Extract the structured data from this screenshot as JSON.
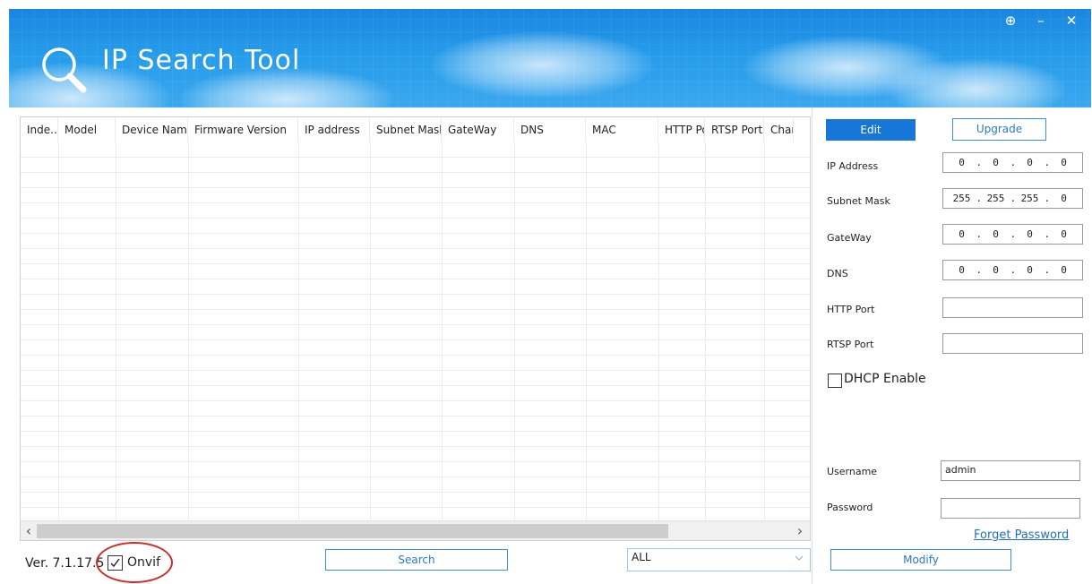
{
  "app": {
    "title": "IP Search Tool",
    "window_buttons": [
      "⊕",
      "–",
      "✕"
    ]
  },
  "table": {
    "columns": [
      "Inde...",
      "Model",
      "Device Name",
      "Firmware Version",
      "IP address",
      "Subnet Mask",
      "GateWay",
      "DNS",
      "MAC",
      "HTTP Port",
      "RTSP Port",
      "Chanr"
    ],
    "rows": []
  },
  "bottom": {
    "version": "Ver. 7.1.17.5",
    "onvif_label": "Onvif",
    "onvif_checked": true,
    "search_label": "Search",
    "filter_value": "ALL",
    "modify_label": "Modify"
  },
  "panel": {
    "edit_tab": "Edit",
    "upgrade_tab": "Upgrade",
    "ip_label": "IP Address",
    "ip_value": [
      "0",
      "0",
      "0",
      "0"
    ],
    "mask_label": "Subnet Mask",
    "mask_value": [
      "255",
      "255",
      "255",
      "0"
    ],
    "gateway_label": "GateWay",
    "gateway_value": [
      "0",
      "0",
      "0",
      "0"
    ],
    "dns_label": "DNS",
    "dns_value": [
      "0",
      "0",
      "0",
      "0"
    ],
    "http_label": "HTTP Port",
    "http_value": "",
    "rtsp_label": "RTSP Port",
    "rtsp_value": "",
    "dhcp_label": "DHCP Enable",
    "dhcp_checked": false,
    "username_label": "Username",
    "username_value": "admin",
    "password_label": "Password",
    "password_value": "",
    "forget_password": "Forget Password"
  },
  "colors": {
    "header_blue": "#1a86df",
    "accent_blue": "#1777d8",
    "link_blue": "#1f6fc4",
    "highlight_red": "#d12a2a"
  }
}
